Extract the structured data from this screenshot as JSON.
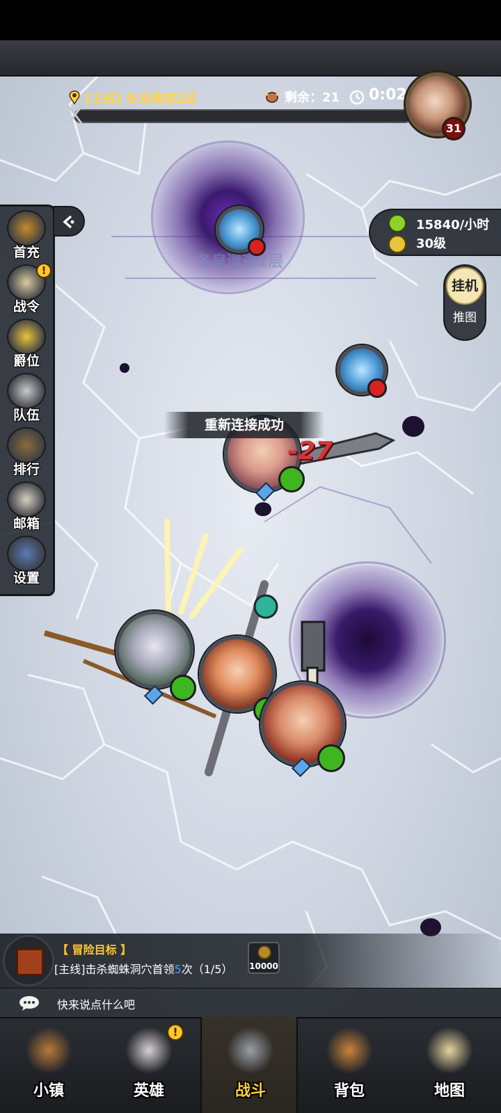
{
  "quest": {
    "title": "[主线] 冬泉遗迹2层",
    "remaining_label": "剩余：",
    "remaining_value": "21",
    "timer": "0:02",
    "boss_level": "31",
    "map_label": "冬泉遗迹2层"
  },
  "side_menu": {
    "items": [
      {
        "label": "首充",
        "icon": "treasure-chest-icon",
        "badge": ""
      },
      {
        "label": "战令",
        "icon": "winged-crest-icon",
        "badge": "!"
      },
      {
        "label": "爵位",
        "icon": "crown-icon",
        "badge": ""
      },
      {
        "label": "队伍",
        "icon": "team-faces-icon",
        "badge": ""
      },
      {
        "label": "排行",
        "icon": "ranking-shield-icon",
        "badge": ""
      },
      {
        "label": "邮箱",
        "icon": "mail-envelope-icon",
        "badge": ""
      },
      {
        "label": "设置",
        "icon": "gear-icon",
        "badge": ""
      }
    ]
  },
  "resources": {
    "income": "15840/小时",
    "level": "30级"
  },
  "mode": {
    "active": "挂机",
    "inactive": "推图"
  },
  "battle": {
    "toast": "重新连接成功",
    "damage": "-27"
  },
  "objective": {
    "title": "【 冒险目标 】",
    "desc_prefix": "[主线]击杀蜘蛛洞穴首领",
    "desc_count": "5",
    "desc_suffix": "次（1/5）",
    "reward_amount": "10000"
  },
  "chat": {
    "placeholder": "快来说点什么吧"
  },
  "nav": {
    "items": [
      {
        "label": "小镇",
        "icon": "town-icon",
        "badge": ""
      },
      {
        "label": "英雄",
        "icon": "hero-elf-icon",
        "badge": "!"
      },
      {
        "label": "战斗",
        "icon": "crossed-swords-icon",
        "badge": "",
        "active": true
      },
      {
        "label": "背包",
        "icon": "backpack-icon",
        "badge": ""
      },
      {
        "label": "地图",
        "icon": "map-scroll-icon",
        "badge": ""
      }
    ]
  },
  "colors": {
    "gold": "#ffd23a",
    "hp_green": "#3fb520",
    "enemy_red": "#d8221f",
    "damage_red": "#d6333a",
    "portal_purple": "#6a2fb0"
  }
}
